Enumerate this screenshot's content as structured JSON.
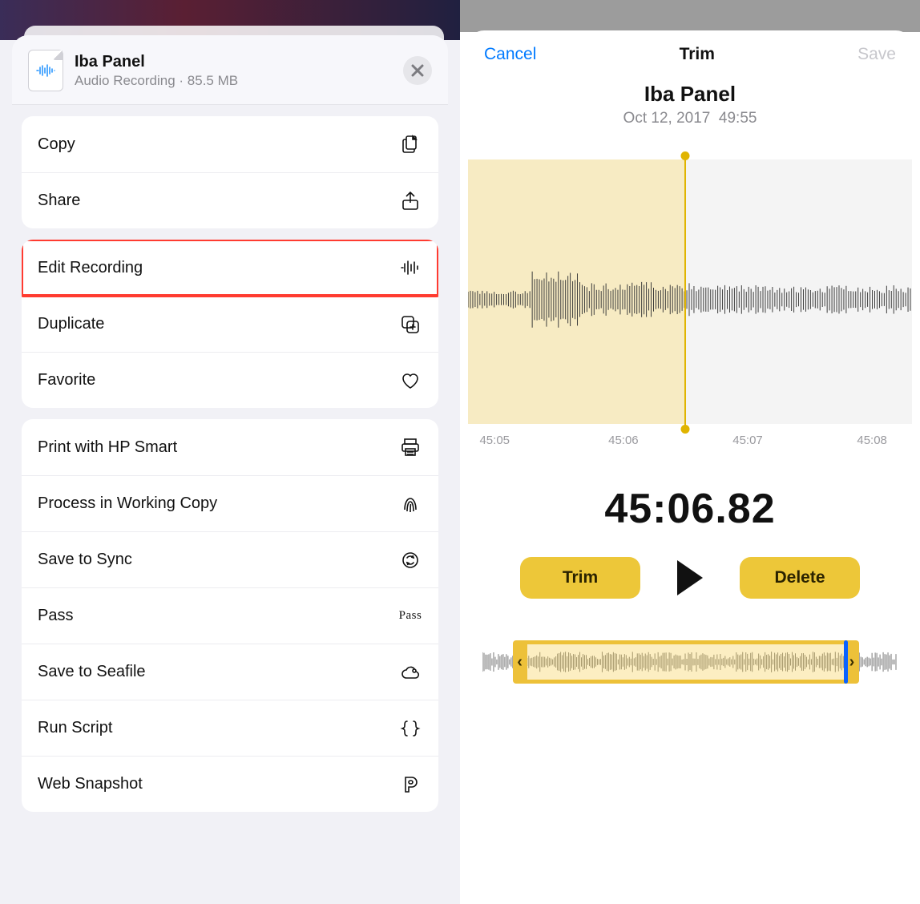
{
  "share": {
    "title": "Iba Panel",
    "subtitle": "Audio Recording · 85.5 MB",
    "groups": [
      {
        "items": [
          {
            "label": "Copy",
            "icon": "copy-icon",
            "highlight": false
          },
          {
            "label": "Share",
            "icon": "share-icon",
            "highlight": false
          }
        ]
      },
      {
        "items": [
          {
            "label": "Edit Recording",
            "icon": "waveform-icon",
            "highlight": true
          },
          {
            "label": "Duplicate",
            "icon": "duplicate-icon",
            "highlight": false
          },
          {
            "label": "Favorite",
            "icon": "heart-icon",
            "highlight": false
          }
        ]
      },
      {
        "items": [
          {
            "label": "Print with HP Smart",
            "icon": "printer-icon",
            "highlight": false
          },
          {
            "label": "Process in Working Copy",
            "icon": "fingerprint-icon",
            "highlight": false
          },
          {
            "label": "Save to Sync",
            "icon": "sync-icon",
            "highlight": false
          },
          {
            "label": "Pass",
            "icon": "pass-text-icon",
            "highlight": false
          },
          {
            "label": "Save to Seafile",
            "icon": "cloud-icon",
            "highlight": false
          },
          {
            "label": "Run Script",
            "icon": "braces-icon",
            "highlight": false
          },
          {
            "label": "Web Snapshot",
            "icon": "p-icon",
            "highlight": false
          }
        ]
      }
    ]
  },
  "trim": {
    "nav": {
      "cancel": "Cancel",
      "title": "Trim",
      "save": "Save"
    },
    "recording": {
      "title": "Iba Panel",
      "date": "Oct 12, 2017",
      "duration": "49:55"
    },
    "timeticks": [
      "45:05",
      "45:06",
      "45:07",
      "45:08"
    ],
    "currentTime": "45:06.82",
    "buttons": {
      "trim": "Trim",
      "delete": "Delete"
    },
    "colors": {
      "selection": "#f5e5b2",
      "accent": "#edc739",
      "playhead": "#e0b400",
      "link": "#007aff"
    }
  }
}
